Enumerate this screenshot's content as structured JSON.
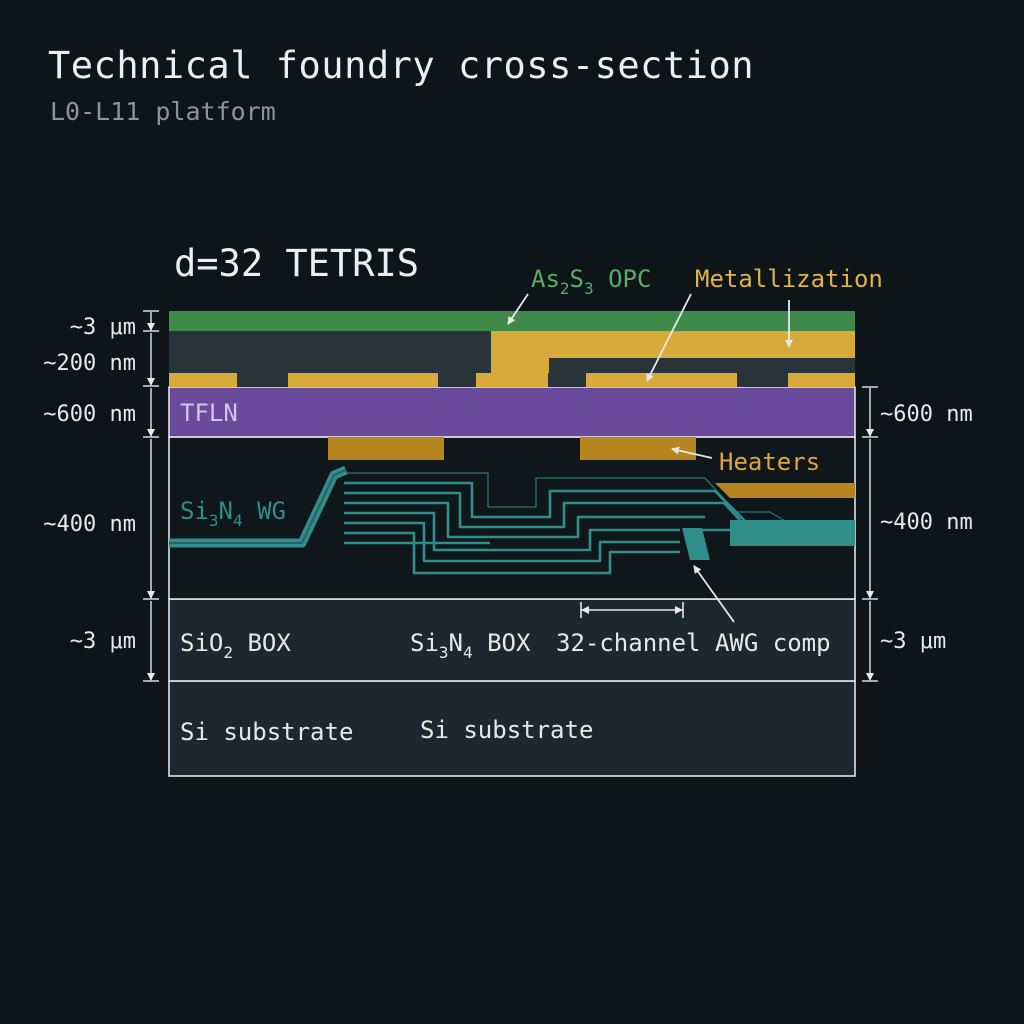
{
  "header": {
    "title": "Technical foundry cross-section",
    "subtitle": "L0-L11 platform"
  },
  "diagram": {
    "label": "d=32 TETRIS",
    "callouts": {
      "opc_base": "As",
      "opc_sub1": "2",
      "opc_mid": "S",
      "opc_sub2": "3",
      "opc_rest": " OPC",
      "metallization": "Metallization",
      "heaters": "Heaters",
      "awg": "32-channel AWG comp"
    },
    "layers": {
      "tfln": "TFLN",
      "wg_base": "Si",
      "wg_sub1": "3",
      "wg_mid": "N",
      "wg_sub2": "4",
      "wg_rest": " WG",
      "box_left_base": "SiO",
      "box_left_sub": "2",
      "box_left_rest": " BOX",
      "box_mid_base": "Si",
      "box_mid_sub1": "3",
      "box_mid_mid": "N",
      "box_mid_sub2": "4",
      "box_mid_rest": " BOX",
      "substrate_left": "Si substrate",
      "substrate_mid": "Si substrate"
    },
    "dimensions": {
      "left": [
        "~3 μm",
        "~200 nm",
        "~600 nm",
        "~400 nm",
        "~3 μm"
      ],
      "right": [
        "~600 nm",
        "~400 nm",
        "~3 μm"
      ]
    },
    "colors": {
      "background": "#0e1519",
      "opc": "#3f8a48",
      "metal": "#d7aa3a",
      "tfln": "#6a4a9a",
      "heater": "#b7851f",
      "waveguide": "#2f8d8c",
      "layer_fill": "#1f2a30",
      "outline": "#dfe4e6"
    }
  }
}
